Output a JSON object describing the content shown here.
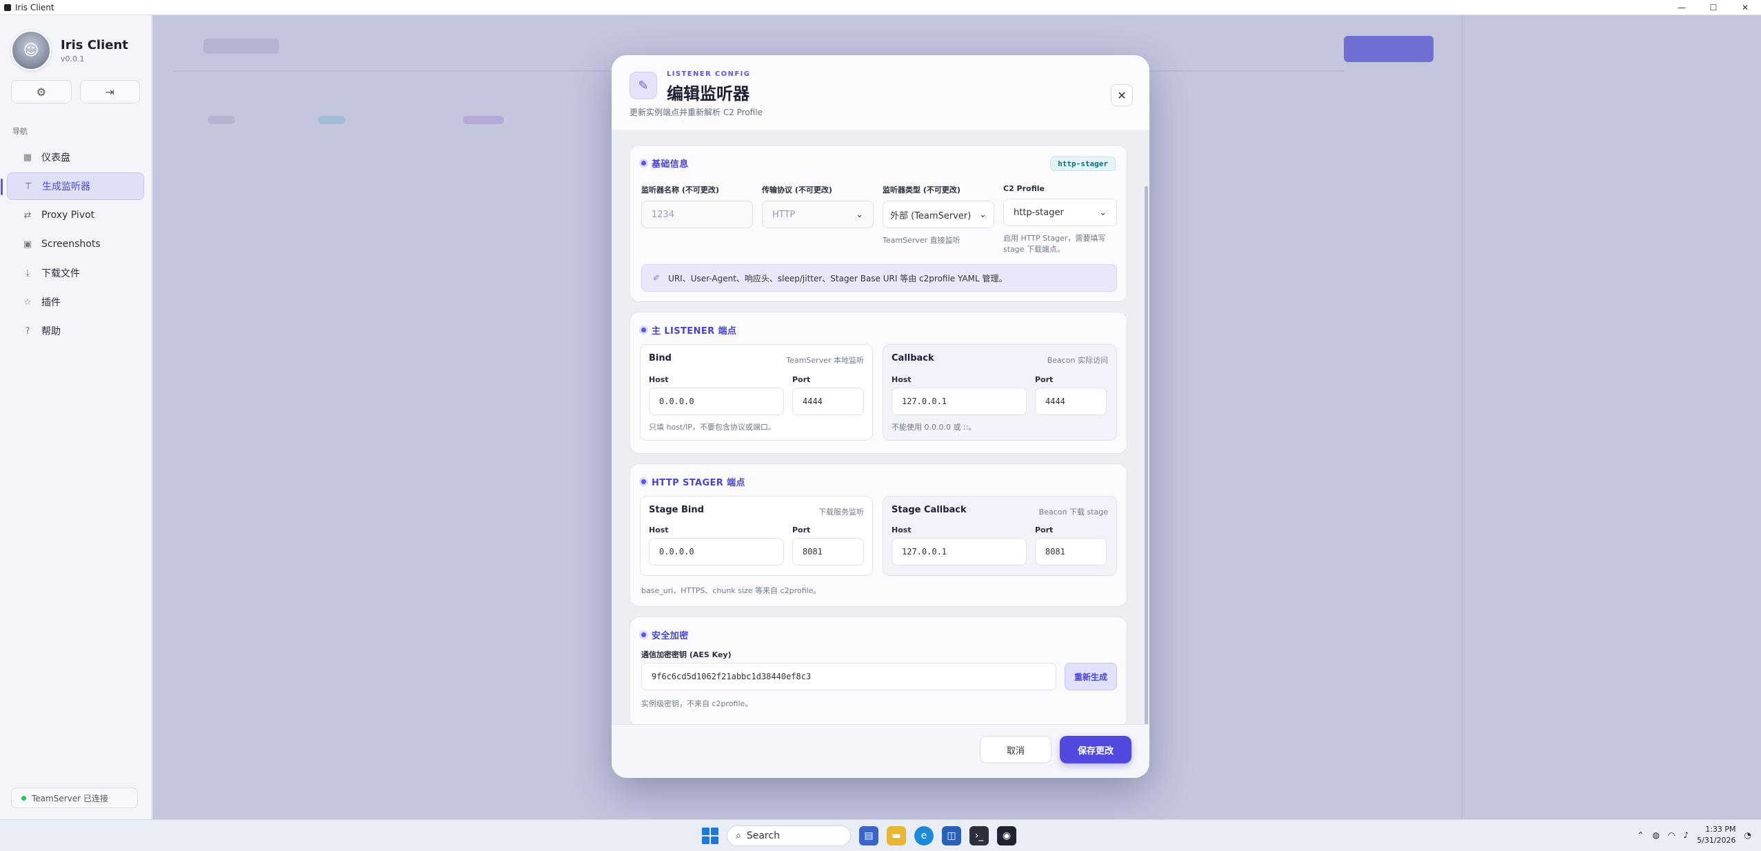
{
  "window": {
    "title": "Iris Client",
    "min": "—",
    "max": "☐",
    "close": "✕"
  },
  "sidebar": {
    "app_name": "Iris Client",
    "version": "v0.0.1",
    "nav_title": "导航",
    "items": [
      {
        "label": "仪表盘",
        "icon": "grid-icon"
      },
      {
        "label": "生成监听器",
        "icon": "antenna-icon",
        "active": true
      },
      {
        "label": "Proxy Pivot",
        "icon": "pivot-icon"
      },
      {
        "label": "Screenshots",
        "icon": "image-icon"
      },
      {
        "label": "下载文件",
        "icon": "download-icon"
      },
      {
        "label": "插件",
        "icon": "star-icon"
      },
      {
        "label": "帮助",
        "icon": "help-icon"
      }
    ],
    "status": "TeamServer 已连接",
    "status_color": "#22c55e"
  },
  "modal": {
    "kicker": "LISTENER CONFIG",
    "title": "编辑监听器",
    "subtitle": "更新实例端点并重新解析 C2 Profile",
    "basic": {
      "title": "基础信息",
      "tag": "http-stager",
      "name_label": "监听器名称 (不可更改)",
      "name_value": "1234",
      "protocol_label": "传输协议 (不可更改)",
      "protocol_value": "HTTP",
      "type_label": "监听器类型 (不可更改)",
      "type_value": "外部 (TeamServer)",
      "type_hint": "TeamServer 直接监听",
      "profile_label": "C2 Profile",
      "profile_value": "http-stager",
      "profile_hint": "启用 HTTP Stager，需要填写 stage 下载端点。",
      "note": "URI、User-Agent、响应头、sleep/jitter、Stager Base URI 等由 c2profile YAML 管理。"
    },
    "main_listener": {
      "title": "主 LISTENER 端点",
      "bind": {
        "title": "Bind",
        "side": "TeamServer 本地监听",
        "host_label": "Host",
        "host": "0.0.0.0",
        "port_label": "Port",
        "port": "4444",
        "hint": "只填 host/IP，不要包含协议或端口。"
      },
      "callback": {
        "title": "Callback",
        "side": "Beacon 实际访问",
        "host_label": "Host",
        "host": "127.0.0.1",
        "port_label": "Port",
        "port": "4444",
        "hint": "不能使用 0.0.0.0 或 ::。"
      }
    },
    "stager": {
      "title": "HTTP STAGER 端点",
      "bind": {
        "title": "Stage Bind",
        "side": "下载服务监听",
        "host_label": "Host",
        "host": "0.0.0.0",
        "port_label": "Port",
        "port": "8081"
      },
      "callback": {
        "title": "Stage Callback",
        "side": "Beacon 下载 stage",
        "host_label": "Host",
        "host": "127.0.0.1",
        "port_label": "Port",
        "port": "8081"
      },
      "hint": "base_uri、HTTPS、chunk size 等来自 c2profile。"
    },
    "security": {
      "title": "安全加密",
      "key_label": "通信加密密钥 (AES Key)",
      "key_value": "9f6c6cd5d1062f21abbc1d38440ef8c3",
      "regen_label": "重新生成",
      "hint": "实例级密钥，不来自 c2profile。"
    },
    "cancel_label": "取消",
    "save_label": "保存更改",
    "accent": "#5149e0"
  },
  "taskbar": {
    "search_placeholder": "Search",
    "time": "1:33 PM",
    "date": "5/31/2026"
  }
}
